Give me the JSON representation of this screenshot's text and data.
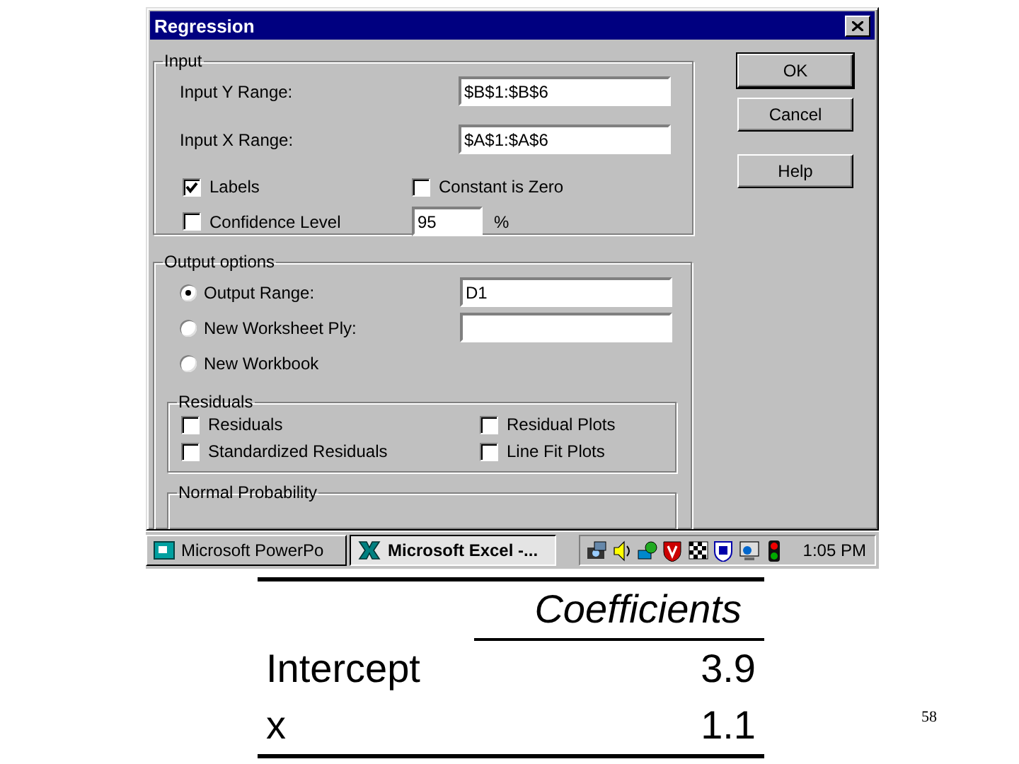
{
  "dialog": {
    "title": "Regression",
    "input": {
      "legend": "Input",
      "ranges": [
        {
          "label": "Input Y Range:",
          "value": "$B$1:$B$6"
        },
        {
          "label": "Input X Range:",
          "value": "$A$1:$A$6"
        }
      ],
      "options": [
        {
          "label": "Labels",
          "checked": true
        },
        {
          "label": "Constant is Zero",
          "checked": false
        },
        {
          "label": "Confidence Level",
          "checked": false
        }
      ],
      "confidence": {
        "value": "95",
        "unit": "%"
      }
    },
    "output": {
      "legend": "Output options",
      "destinations": [
        {
          "label": "Output Range:",
          "selected": true,
          "kind": "field",
          "value": "D1"
        },
        {
          "label": "New Worksheet Ply:",
          "selected": false,
          "kind": "field"
        },
        {
          "label": "New Workbook",
          "selected": false,
          "kind": "plain"
        }
      ],
      "residuals": {
        "legend": "Residuals",
        "options": [
          {
            "label": "Residuals",
            "checked": false
          },
          {
            "label": "Residual Plots",
            "checked": false
          },
          {
            "label": "Standardized Residuals",
            "checked": false
          },
          {
            "label": "Line Fit Plots",
            "checked": false
          }
        ]
      },
      "normal_probability": {
        "legend": "Normal Probability"
      }
    },
    "buttons": [
      {
        "label": "OK",
        "default": true
      },
      {
        "label": "Cancel",
        "default": false
      },
      {
        "label": "Help",
        "default": false
      }
    ]
  },
  "taskbar": {
    "tasks": [
      {
        "label": "Microsoft PowerPo",
        "selected": false
      },
      {
        "label": "Microsoft Excel -...",
        "selected": true
      }
    ],
    "clock": "1:05 PM"
  },
  "table": {
    "header": "Coefficients",
    "rows": [
      {
        "label": "Intercept",
        "value": "3.9"
      },
      {
        "label": "x",
        "value": "1.1"
      }
    ]
  },
  "page_number": "58"
}
